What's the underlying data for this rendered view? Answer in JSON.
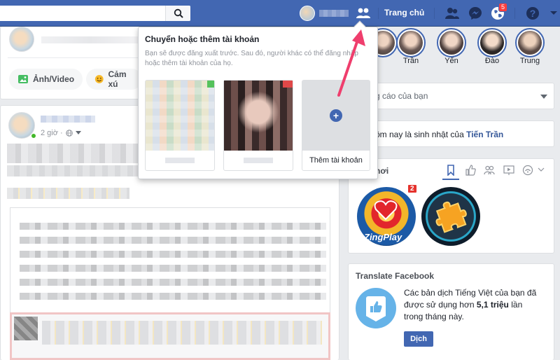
{
  "header": {
    "search_placeholder": "",
    "home_label": "Trang chủ",
    "notification_count": "5"
  },
  "feed": {
    "composer_buttons": [
      "Ảnh/Video",
      "Cảm xú"
    ],
    "post_time": "2 giờ ·"
  },
  "switch_accounts": {
    "title": "Chuyển hoặc thêm tài khoản",
    "description": "Bạn sẽ được đăng xuất trước. Sau đó, người khác có thể đăng nhập hoặc thêm tài khoản của họ.",
    "add_account_label": "Thêm tài khoản"
  },
  "stories": {
    "names": [
      "",
      "Trần",
      "Yến",
      "Đào",
      "Trung"
    ]
  },
  "right": {
    "ads_label": "g cáo của bạn",
    "birthday_text": "ôm nay là sinh nhật của",
    "birthday_name": "Tiến Trần",
    "games_title": "hơi",
    "game_badge": "2",
    "game_label": "ZingPlay",
    "translate_title": "Translate Facebook",
    "translate_text_1": "Các bản dịch Tiếng Việt của bạn đã",
    "translate_text_2": "được sử dụng hơn ",
    "translate_bold": "5,1 triệu",
    "translate_text_3": " lần",
    "translate_text_4": "trong tháng này.",
    "translate_button": "Dịch"
  },
  "colors": {
    "brand_blue": "#4267b2",
    "arrow": "#ef3e6d",
    "badge_red": "#fa3e3e",
    "online_green": "#42b72a"
  },
  "icons": [
    "search-icon",
    "friends-icon",
    "friend-requests-icon",
    "messenger-icon",
    "globe-icon",
    "help-icon",
    "photo-icon",
    "emoji-icon",
    "chevron-down-icon",
    "plus-icon",
    "bookmark-icon",
    "like-icon",
    "people-icon",
    "video-icon",
    "wifi-icon",
    "thumbs-up-medal-icon"
  ]
}
